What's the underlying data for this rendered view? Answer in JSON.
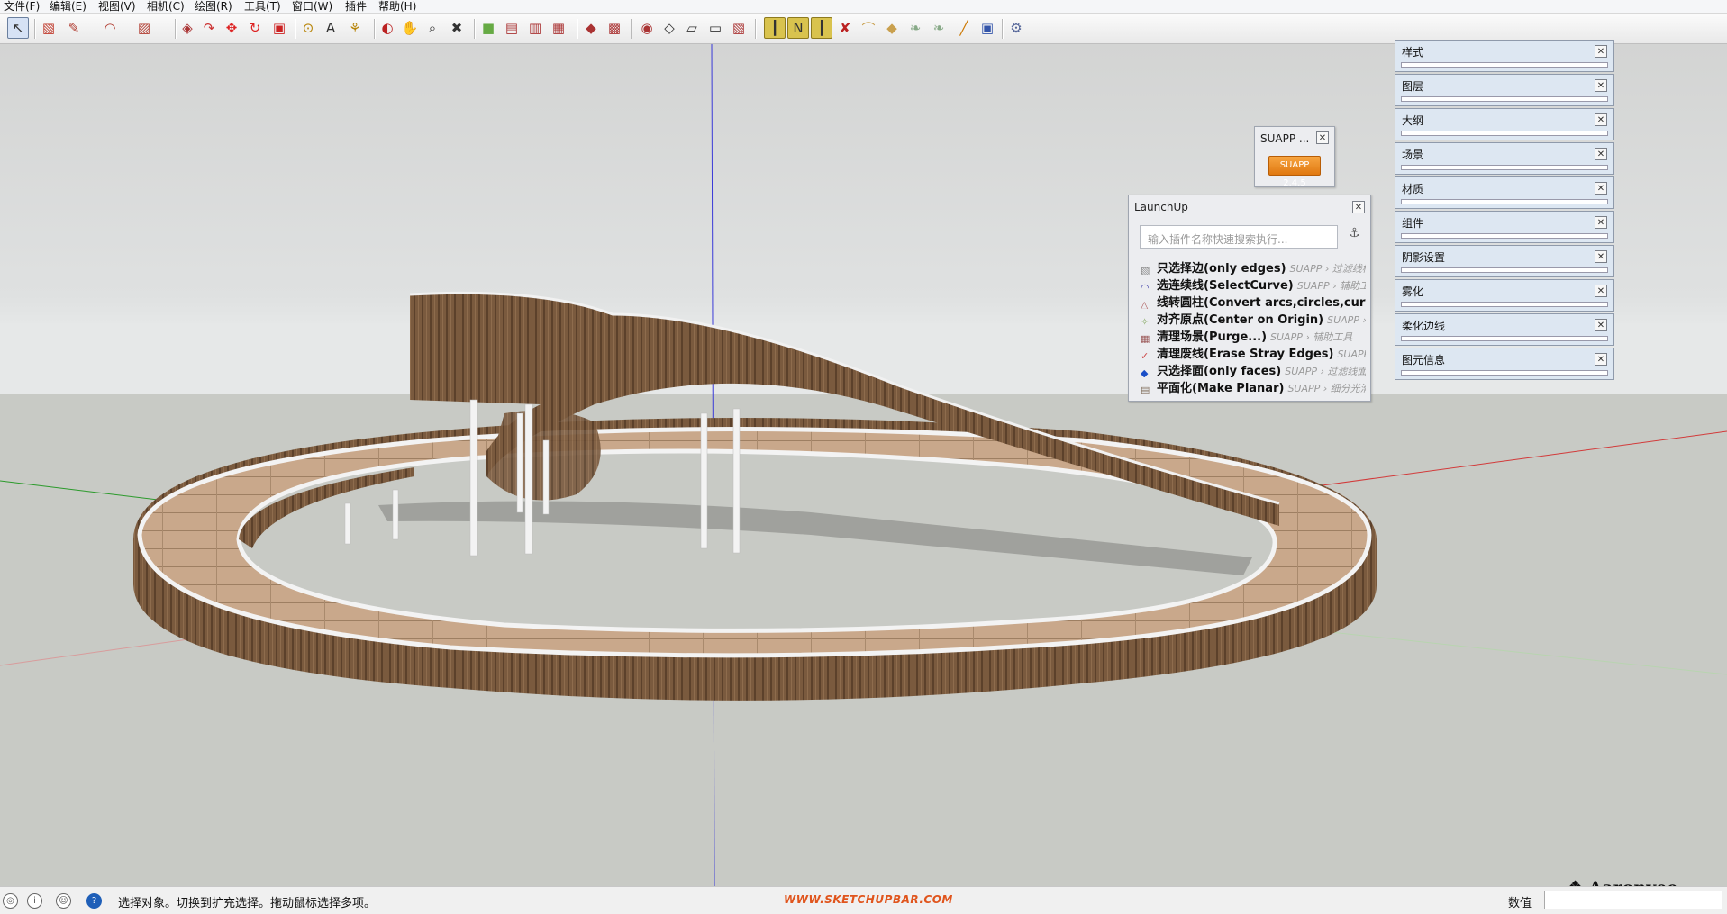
{
  "menu": [
    "文件(F)",
    "编辑(E)",
    "视图(V)",
    "相机(C)",
    "绘图(R)",
    "工具(T)",
    "窗口(W)",
    "插件",
    "帮助(H)"
  ],
  "toolbar": {
    "icons": [
      "select-icon",
      "eraser-icon",
      "pencil-icon",
      "arc-icon",
      "rectangle-icon",
      "pushpull-icon",
      "followme-icon",
      "move-icon",
      "rotate-icon",
      "scale-icon",
      "tape-icon",
      "text-icon",
      "paint-icon",
      "orbit-icon",
      "pan-icon",
      "zoom-icon",
      "zoom-extents-icon",
      "iso-view-icon",
      "top-view-icon",
      "front-view-icon",
      "right-view-icon",
      "back-view-icon",
      "left-view-icon",
      "xray-icon",
      "wireframe-icon",
      "hidden-line-icon",
      "shaded-icon",
      "textured-icon",
      "sandbox-from-contours-icon",
      "sandbox-from-scratch-icon",
      "sandbox-smoove-icon",
      "sandbox-stamp-icon",
      "sandbox-drape-icon",
      "sandbox-add-detail-icon",
      "sandbox-flip-edge-icon",
      "suapp-tool-icon",
      "suapp-plugin-icon",
      "extension-icon"
    ]
  },
  "suapp": {
    "title": "SUAPP ...",
    "button_label": "SUAPP 2.4.5"
  },
  "launchup": {
    "title": "LaunchUp",
    "search_placeholder": "输入插件名称快速搜索执行...",
    "items": [
      {
        "label": "只选择边(only edges)",
        "path": "SUAPP › 过滤线框"
      },
      {
        "label": "选连续线(SelectCurve)",
        "path": "SUAPP › 辅助工"
      },
      {
        "label": "线转圆柱(Convert arcs,circles,curve",
        "path": ""
      },
      {
        "label": "对齐原点(Center on Origin)",
        "path": "SUAPP ›"
      },
      {
        "label": "清理场景(Purge...)",
        "path": "SUAPP › 辅助工具"
      },
      {
        "label": "清理废线(Erase Stray Edges)",
        "path": "SUAPP ›"
      },
      {
        "label": "只选择面(only faces)",
        "path": "SUAPP › 过滤线面"
      },
      {
        "label": "平面化(Make Planar)",
        "path": "SUAPP › 细分光滑"
      }
    ]
  },
  "trays": [
    "样式",
    "图层",
    "大纲",
    "场景",
    "材质",
    "组件",
    "阴影设置",
    "雾化",
    "柔化边线",
    "图元信息"
  ],
  "watermark": "Aaronyee",
  "status": {
    "text": "选择对象。切换到扩充选择。拖动鼠标选择多项。",
    "url": "WWW.SKETCHUPBAR.COM",
    "measure_label": "数值",
    "measure_value": ""
  }
}
